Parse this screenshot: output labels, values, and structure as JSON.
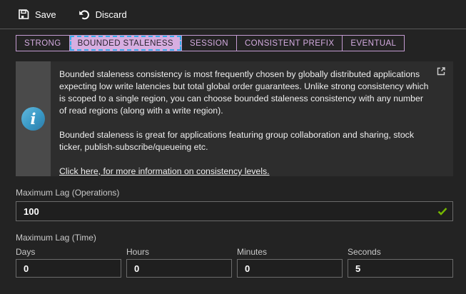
{
  "toolbar": {
    "save_label": "Save",
    "discard_label": "Discard"
  },
  "tabs": {
    "selected": "BOUNDED STALENESS",
    "items": [
      {
        "label": "STRONG",
        "selected": false
      },
      {
        "label": "BOUNDED STALENESS",
        "selected": true
      },
      {
        "label": "SESSION",
        "selected": false
      },
      {
        "label": "CONSISTENT PREFIX",
        "selected": false
      },
      {
        "label": "EVENTUAL",
        "selected": false
      }
    ]
  },
  "info_box": {
    "paragraph_1": "Bounded staleness consistency is most frequently chosen by globally distributed applications expecting low write latencies but total global order guarantees. Unlike strong consistency which is scoped to a single region, you can choose bounded staleness consistency with any number of read regions (along with a write region).",
    "paragraph_2": "Bounded staleness is great for applications featuring group collaboration and sharing, stock ticker, publish-subscribe/queueing etc.",
    "link_text": "Click here, for more information on consistency levels.",
    "icons": {
      "left": "info-icon",
      "top_right": "external-link-icon"
    }
  },
  "fields": {
    "operations": {
      "label": "Maximum Lag (Operations)",
      "value": "100",
      "valid": true
    },
    "time": {
      "label": "Maximum Lag (Time)",
      "subfields": [
        {
          "label": "Days",
          "value": "0"
        },
        {
          "label": "Hours",
          "value": "0"
        },
        {
          "label": "Minutes",
          "value": "0"
        },
        {
          "label": "Seconds",
          "value": "5"
        }
      ]
    }
  },
  "colors": {
    "background": "#232323",
    "info_panel_bg": "#2d2d2d",
    "info_strip_bg": "#4a4a4a",
    "info_icon_blue": "#3999c6",
    "tab_border_purple": "#c49bd2",
    "tab_text_purple": "#d4abe0",
    "selected_tab_bg": "#d7aee1",
    "focus_dashed_cyan": "#36ace8",
    "valid_green": "#76b900",
    "input_border": "#6b6b6b"
  }
}
